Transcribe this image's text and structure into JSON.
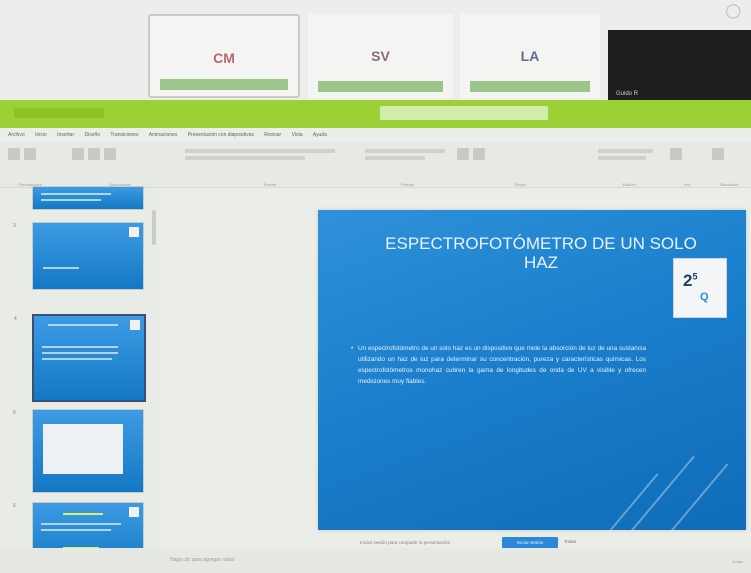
{
  "participants": [
    {
      "initials": "CM",
      "name": ""
    },
    {
      "initials": "SV",
      "name": ""
    },
    {
      "initials": "LA",
      "name": ""
    }
  ],
  "dark_tile": {
    "name": "Guido R"
  },
  "titlebar": {
    "doc_title": "",
    "search_placeholder": ""
  },
  "menu": [
    "Archivo",
    "Inicio",
    "Insertar",
    "Diseño",
    "Transiciones",
    "Animaciones",
    "Presentación con diapositivas",
    "Revisar",
    "Vista",
    "Ayuda"
  ],
  "ribbon_groups": [
    "Portapapeles",
    "Diapositivas",
    "Fuente",
    "Párrafo",
    "Dibujo",
    "Edición",
    "Voz",
    "Diseñador"
  ],
  "thumbnails": [
    {
      "num": ""
    },
    {
      "num": "3"
    },
    {
      "num": "4"
    },
    {
      "num": "5"
    },
    {
      "num": "6"
    }
  ],
  "slide": {
    "title": "ESPECTROFOTÓMETRO DE UN SOLO HAZ",
    "logo_text": "2",
    "logo_sup": "5",
    "logo_q": "Q",
    "body": "Un espectrofotómetro de un solo haz es un dispositivo que mide la absorción de luz de una sustancia utilizando un haz de luz para determinar su concentración, pureza y características químicas. Los espectrofotómetros monohaz cubren la gama de longitudes de onda de UV a visible y ofrecen mediciones muy fiables."
  },
  "statusbar": {
    "notes_hint": "Haga clic para agregar notas",
    "notice_text": "Iniciar sesión para compartir la presentación",
    "notice_button": "Iniciar sesión",
    "notice_close": "Todas",
    "zoom": "Notas"
  },
  "colors": {
    "accent": "#9bd134",
    "slide_blue": "#1b7fcd"
  }
}
